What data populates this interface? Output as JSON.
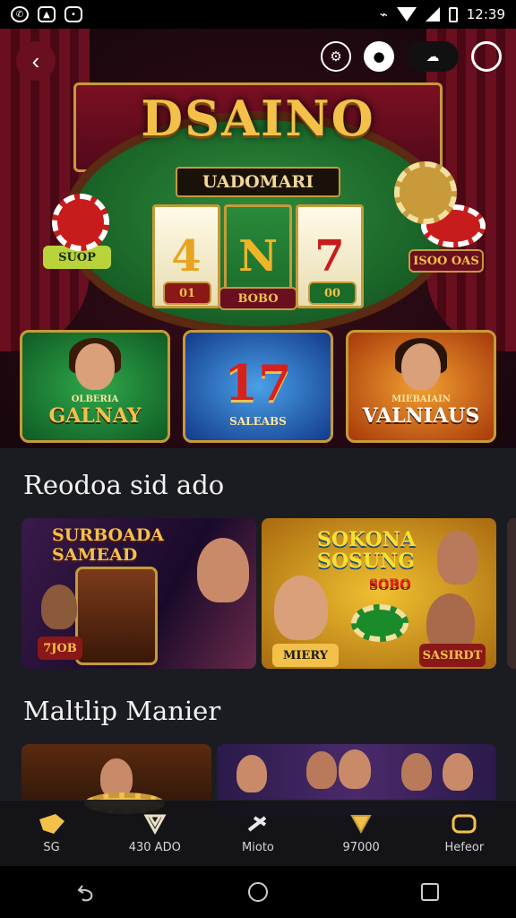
{
  "status_bar": {
    "time": "12:39",
    "icons": [
      "whatsapp-icon",
      "gallery-icon",
      "chat-icon",
      "vibrate-icon",
      "wifi-icon",
      "signal-icon",
      "battery-icon"
    ]
  },
  "hero": {
    "logo_text": "DSAINO",
    "sublogo_text": "UADOMARI",
    "reels": [
      "4",
      "N",
      "7"
    ],
    "reel_values": [
      "01",
      "00"
    ],
    "left_tag": "SUOP",
    "right_tag": "ISOO OAS",
    "center_tag": "BOBO",
    "icons": [
      "back-icon",
      "settings-icon",
      "profile-icon",
      "cloud-icon",
      "circle-icon"
    ]
  },
  "featured_games": [
    {
      "title": "GALNAY",
      "sub": "OLBERIA"
    },
    {
      "title": "17",
      "sub": "SALEABS"
    },
    {
      "title": "VALNIAUS",
      "sub": "MIEBAIAIN"
    }
  ],
  "section1": {
    "title": "Reodoa sid ado",
    "promos": [
      {
        "title": "SURBOADA SAMEAD",
        "badge": "7JOB"
      },
      {
        "title": "SOKONA SOSUNG",
        "sub": "SOBO",
        "badges": [
          "MIERY",
          "SASIRDT"
        ]
      }
    ]
  },
  "section2": {
    "title": "Maltlip Manier"
  },
  "bottom_nav": [
    {
      "label": "SG",
      "icon": "home-icon"
    },
    {
      "label": "430 ADO",
      "icon": "games-icon"
    },
    {
      "label": "Mioto",
      "icon": "gamepad-icon"
    },
    {
      "label": "97000",
      "icon": "wallet-icon"
    },
    {
      "label": "Hefeor",
      "icon": "profile-icon"
    }
  ],
  "colors": {
    "gold": "#f3c14a",
    "felt": "#1d6a2b",
    "curtain": "#6a0f1f",
    "bg": "#1b1c21"
  }
}
